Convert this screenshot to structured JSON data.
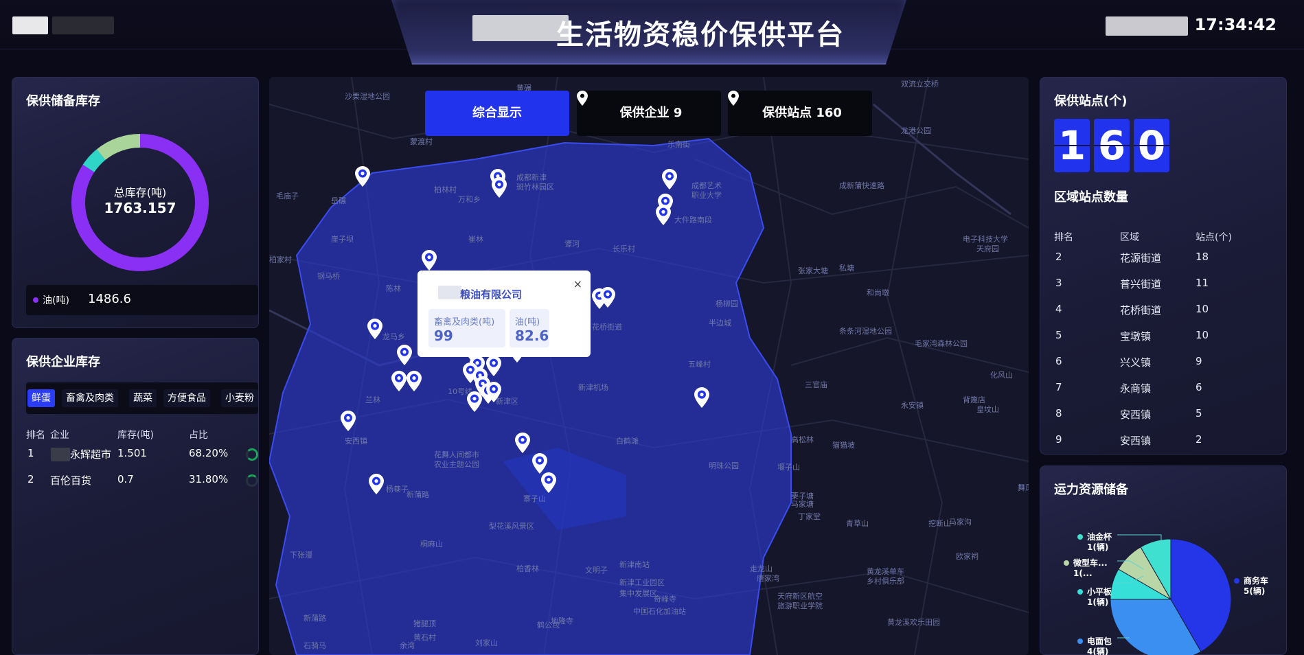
{
  "header": {
    "title": "生活物资稳价保供平台",
    "time": "17:34:42",
    "left_badge": "…"
  },
  "inventory_panel": {
    "title": "保供储备库存",
    "total_label": "总库存(吨)",
    "total_value": "1763.157",
    "legend": {
      "label": "油(吨)",
      "value": "1486.6",
      "color": "#8a2ff4"
    },
    "donut_segments": [
      {
        "name": "油",
        "value": 1486.6,
        "color": "#8a2ff4"
      },
      {
        "name": "segment-2",
        "value": 85,
        "color": "#2fd6c8"
      },
      {
        "name": "segment-3",
        "value": 191.557,
        "color": "#a9d49a"
      }
    ]
  },
  "enterprise_panel": {
    "title": "保供企业库存",
    "tabs": [
      "鲜蛋",
      "畜禽及肉类",
      "蔬菜",
      "方便食品",
      "小麦粉"
    ],
    "active_tab": 0,
    "headers": [
      "排名",
      "企业",
      "库存(吨)",
      "占比"
    ],
    "rows": [
      {
        "rank": "1",
        "name": "永辉超市",
        "stock": "1.501",
        "ratio": "68.20%",
        "fraction": 0.682
      },
      {
        "rank": "2",
        "name": "百伦百货",
        "stock": "0.7",
        "ratio": "31.80%",
        "fraction": 0.318
      }
    ]
  },
  "map": {
    "buttons": [
      {
        "label": "综合显示",
        "active": true
      },
      {
        "label": "保供企业 9",
        "active": false
      },
      {
        "label": "保供站点 160",
        "active": false
      }
    ],
    "popup": {
      "title": "粮油有限公司",
      "close": "×",
      "cards": [
        {
          "label": "畜禽及肉类(吨)",
          "value": "99"
        },
        {
          "label": "油(吨)",
          "value": "82.6"
        }
      ]
    },
    "labels": [
      "沙栗湿地公园",
      "黄碾",
      "双流立交桥",
      "蒙渡村",
      "成都新津",
      "斑竹林园区",
      "柏林村",
      "万和乡",
      "乐南街",
      "成都艺术",
      "职业大学",
      "大件路南段",
      "龙港公园",
      "毛庙子",
      "岳碾",
      "崖子坝",
      "崔林",
      "谭河",
      "长乐村",
      "柏家村",
      "钢马桥",
      "陈林",
      "张家大塘",
      "私塘",
      "电子科技大学",
      "天府园",
      "和尚墩",
      "杨柳园",
      "花桥街道",
      "半边城",
      "五峰村",
      "龙马乡",
      "条条河湿地公园",
      "毛家湾森林公园",
      "化风山",
      "新津机场",
      "新津区",
      "兰林",
      "10号线",
      "安西镇",
      "花舞人间都市",
      "农业主题公园",
      "白鹤滩",
      "三官庙",
      "永安镇",
      "背篾店",
      "皇坟山",
      "高松林",
      "猫猫坡",
      "明珠公园",
      "新蒲路",
      "杨巷子",
      "寨子山",
      "堰子山",
      "栗子塘",
      "马家塘",
      "丁家堂",
      "青草山",
      "挖断山",
      "马家沟",
      "梨花溪风景区",
      "桐麻山",
      "下张漫",
      "柏香林",
      "文明子",
      "新津南站",
      "新津工业园区",
      "集中发展区",
      "奇峰寺",
      "中国石化加油站",
      "走龙山",
      "唐家湾",
      "天府新区航空",
      "旅游职业学院",
      "黄龙溪单车",
      "乡村俱乐部",
      "黄龙溪欢乐田园",
      "欧家祠",
      "舞凤",
      "石骑马",
      "余湾",
      "黄石村",
      "刘家山",
      "鹤公包",
      "猪腿顶",
      "地隆寺",
      "新蒲路",
      "成新蒲快速路"
    ]
  },
  "stations_panel": {
    "title": "保供站点(个)",
    "digits": [
      "1",
      "6",
      "0"
    ],
    "sub_title": "区域站点数量",
    "headers": [
      "排名",
      "区域",
      "站点(个)"
    ],
    "rows": [
      {
        "rank": "2",
        "area": "花源街道",
        "count": "18"
      },
      {
        "rank": "3",
        "area": "普兴街道",
        "count": "11"
      },
      {
        "rank": "4",
        "area": "花桥街道",
        "count": "10"
      },
      {
        "rank": "5",
        "area": "宝墩镇",
        "count": "10"
      },
      {
        "rank": "6",
        "area": "兴义镇",
        "count": "9"
      },
      {
        "rank": "7",
        "area": "永商镇",
        "count": "6"
      },
      {
        "rank": "8",
        "area": "安西镇",
        "count": "5"
      },
      {
        "rank": "9",
        "area": "安西镇",
        "count": "2"
      }
    ]
  },
  "transport_panel": {
    "title": "运力资源储备",
    "slices": [
      {
        "name": "商务车",
        "value": 5,
        "unit": "5(辆)",
        "color": "#2536e8"
      },
      {
        "name": "电面包",
        "value": 4,
        "unit": "4(辆)",
        "color": "#3a8ff0"
      },
      {
        "name": "小平板",
        "value": 1,
        "unit": "1(辆)",
        "color": "#36e0d8"
      },
      {
        "name": "微型车...",
        "value": 1,
        "unit": "1(...",
        "color": "#b9d6a6"
      },
      {
        "name": "油金杯",
        "value": 1,
        "unit": "1(辆)",
        "color": "#3fe0d0"
      }
    ]
  }
}
